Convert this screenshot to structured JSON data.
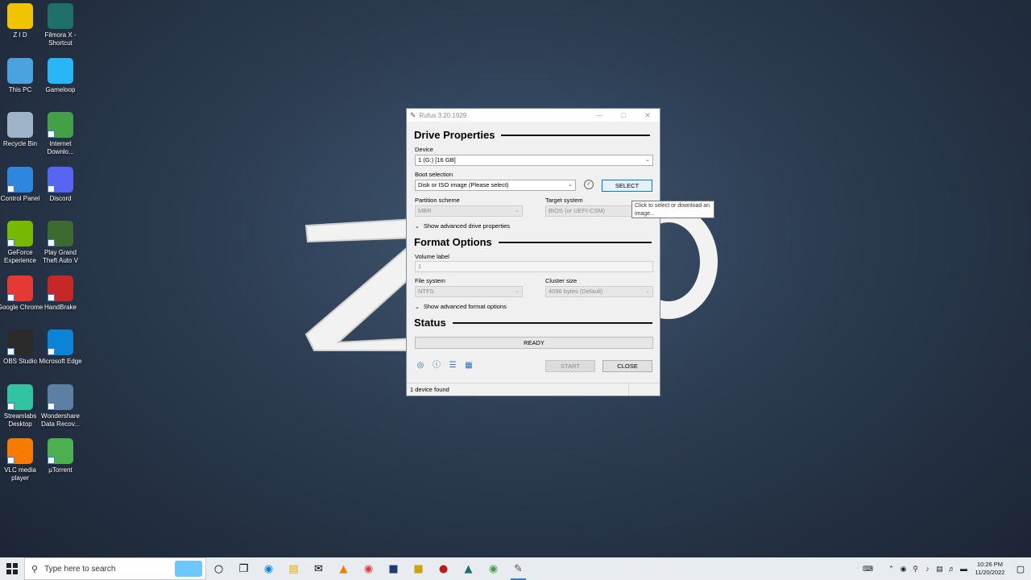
{
  "desktop": {
    "icons": [
      {
        "label": "Z I D",
        "color": "#f2c300"
      },
      {
        "label": "Filmora X - Shortcut",
        "color": "#1f6f6a"
      },
      {
        "label": "This PC",
        "color": "#4aa3df"
      },
      {
        "label": "Gameloop",
        "color": "#29b6f6"
      },
      {
        "label": "Recycle Bin",
        "color": "#9fb3c8"
      },
      {
        "label": "Internet Downlo...",
        "color": "#43a047"
      },
      {
        "label": "Control Panel",
        "color": "#2e86de"
      },
      {
        "label": "Discord",
        "color": "#5865f2"
      },
      {
        "label": "GeForce Experience",
        "color": "#76b900"
      },
      {
        "label": "Play Grand Theft Auto V",
        "color": "#3d6b2f"
      },
      {
        "label": "Google Chrome",
        "color": "#e53935"
      },
      {
        "label": "HandBrake",
        "color": "#c62828"
      },
      {
        "label": "OBS Studio",
        "color": "#2b2b2b"
      },
      {
        "label": "Microsoft Edge",
        "color": "#0a84d6"
      },
      {
        "label": "Streamlabs Desktop",
        "color": "#31c3a2"
      },
      {
        "label": "Wondershare Data Recov...",
        "color": "#5c7fa3"
      },
      {
        "label": "VLC media player",
        "color": "#f57c00"
      },
      {
        "label": "µTorrent",
        "color": "#4caf50"
      }
    ]
  },
  "rufus": {
    "title": "Rufus 3.20.1929",
    "controls": {
      "minimize": "—",
      "maximize": "□",
      "close": "✕"
    },
    "drive_properties": {
      "heading": "Drive Properties",
      "device_label": "Device",
      "device_value": "1 (G:) [16 GB]",
      "boot_label": "Boot selection",
      "boot_value": "Disk or ISO image (Please select)",
      "select_button": "SELECT",
      "partition_label": "Partition scheme",
      "partition_value": "MBR",
      "target_label": "Target system",
      "target_value": "BIOS (or UEFI-CSM)",
      "advanced": "Show advanced drive properties"
    },
    "format_options": {
      "heading": "Format Options",
      "volume_label": "Volume label",
      "volume_value": "1",
      "fs_label": "File system",
      "fs_value": "NTFS",
      "cluster_label": "Cluster size",
      "cluster_value": "4096 bytes (Default)",
      "advanced": "Show advanced format options"
    },
    "status": {
      "heading": "Status",
      "state": "READY",
      "start_button": "START",
      "close_button": "CLOSE",
      "statusbar": "1 device found"
    }
  },
  "tooltip": {
    "text": "Click to select or download an image..."
  },
  "taskbar": {
    "search_placeholder": "Type here to search",
    "time": "10:26 PM",
    "date": "11/20/2022"
  },
  "colors": {
    "accent": "#3a7bd5",
    "select_button_bg": "#e5f1fb",
    "select_button_border": "#0078d7",
    "progress_bg": "#e6e6e6"
  }
}
